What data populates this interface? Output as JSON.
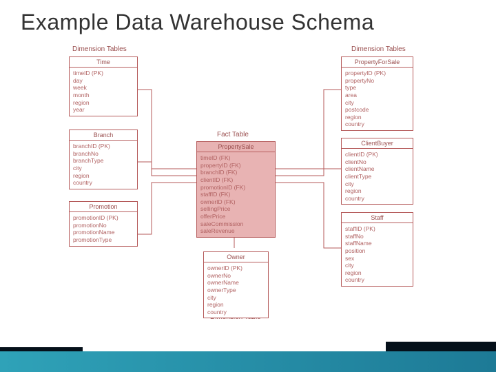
{
  "title": "Example Data Warehouse Schema",
  "section_labels": {
    "dim_left": "Dimension Tables",
    "dim_right": "Dimension Tables",
    "dim_bottom": "Dimension Table",
    "fact": "Fact Table"
  },
  "tables": {
    "time": {
      "name": "Time",
      "fields": [
        "timeID (PK)",
        "day",
        "week",
        "month",
        "region",
        "year"
      ]
    },
    "branch": {
      "name": "Branch",
      "fields": [
        "branchID (PK)",
        "branchNo",
        "branchType",
        "city",
        "region",
        "country"
      ]
    },
    "promotion": {
      "name": "Promotion",
      "fields": [
        "promotionID (PK)",
        "promotionNo",
        "promotionName",
        "promotionType"
      ]
    },
    "propertysale": {
      "name": "PropertySale",
      "fields": [
        "timeID (FK)",
        "propertyID (FK)",
        "branchID (FK)",
        "clientID (FK)",
        "promotionID (FK)",
        "staffID (FK)",
        "ownerID (FK)",
        "sellingPrice",
        "offerPrice",
        "saleCommission",
        "saleRevenue"
      ]
    },
    "owner": {
      "name": "Owner",
      "fields": [
        "ownerID (PK)",
        "ownerNo",
        "ownerName",
        "ownerType",
        "city",
        "region",
        "country"
      ]
    },
    "propertyforsale": {
      "name": "PropertyForSale",
      "fields": [
        "propertyID (PK)",
        "propertyNo",
        "type",
        "area",
        "city",
        "postcode",
        "region",
        "country"
      ]
    },
    "clientbuyer": {
      "name": "ClientBuyer",
      "fields": [
        "clientID (PK)",
        "clientNo",
        "clientName",
        "clientType",
        "city",
        "region",
        "country"
      ]
    },
    "staff": {
      "name": "Staff",
      "fields": [
        "staffID (PK)",
        "staffNo",
        "staffName",
        "position",
        "sex",
        "city",
        "region",
        "country"
      ]
    }
  }
}
